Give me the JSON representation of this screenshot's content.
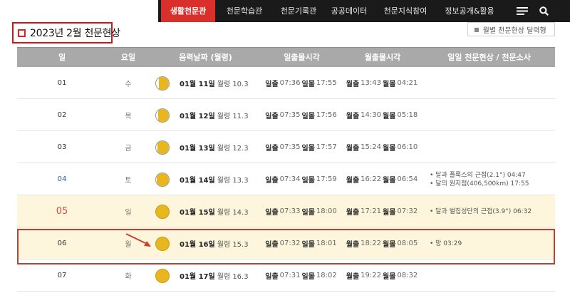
{
  "nav": {
    "items": [
      "생활천문관",
      "천문학습관",
      "천문기록관",
      "공공데이터",
      "천문지식참여",
      "정보공개&활용"
    ],
    "active_index": 0,
    "menu_icon": "hamburger-menu-icon",
    "search_icon": "search-icon"
  },
  "page_title": "2023년 2월 천문현상",
  "calendar_button": "월별 천문현상 달력형",
  "table": {
    "headers": [
      "일",
      "요일",
      "음력날짜 (월령)",
      "일출몰시각",
      "월출몰시각",
      "일일 천문현상 / 천문소사"
    ],
    "labels": {
      "sunrise": "일출",
      "sunset": "일몰",
      "moonrise": "월출",
      "moonset": "월몰",
      "age": "월령"
    },
    "rows": [
      {
        "day": "01",
        "weekday": "수",
        "lunar": "01월 11일",
        "age": "10.3",
        "phase": 0.78,
        "sunrise": "07:36",
        "sunset": "17:55",
        "moonrise": "13:43",
        "moonset": "04:21",
        "events": []
      },
      {
        "day": "02",
        "weekday": "목",
        "lunar": "01월 12일",
        "age": "11.3",
        "phase": 0.85,
        "sunrise": "07:35",
        "sunset": "17:56",
        "moonrise": "14:30",
        "moonset": "05:18",
        "events": []
      },
      {
        "day": "03",
        "weekday": "금",
        "lunar": "01월 13일",
        "age": "12.3",
        "phase": 0.9,
        "sunrise": "07:35",
        "sunset": "17:57",
        "moonrise": "15:24",
        "moonset": "06:10",
        "events": []
      },
      {
        "day": "04",
        "weekday": "토",
        "lunar": "01월 14일",
        "age": "13.3",
        "phase": 0.95,
        "sunrise": "07:34",
        "sunset": "17:59",
        "moonrise": "16:22",
        "moonset": "06:54",
        "events": [
          "• 달과 폴룩스의 근접(2.1°) 04:47",
          "• 달의 원지점(406,500km) 17:55"
        ]
      },
      {
        "day": "05",
        "weekday": "일",
        "lunar": "01월 15일",
        "age": "14.3",
        "phase": 1.0,
        "sunrise": "07:33",
        "sunset": "18:00",
        "moonrise": "17:21",
        "moonset": "07:32",
        "events": [
          "• 달과 벌집성단의 근접(3.9°) 06:32"
        ]
      },
      {
        "day": "06",
        "weekday": "월",
        "lunar": "01월 16일",
        "age": "15.3",
        "phase": 1.0,
        "sunrise": "07:32",
        "sunset": "18:01",
        "moonrise": "18:22",
        "moonset": "08:05",
        "events": [
          "• 망 03:29"
        ]
      },
      {
        "day": "07",
        "weekday": "화",
        "lunar": "01월 17일",
        "age": "16.3",
        "phase": 1.0,
        "sunrise": "07:31",
        "sunset": "18:02",
        "moonrise": "19:22",
        "moonset": "08:32",
        "events": []
      }
    ]
  },
  "colors": {
    "nav_bg": "#1a1a1a",
    "nav_active": "#d9302c",
    "header_bg": "#a9a9a9",
    "highlight_row": "#fdf6dc",
    "moon": "#e8b61d",
    "annotation_red": "#c0402e"
  }
}
